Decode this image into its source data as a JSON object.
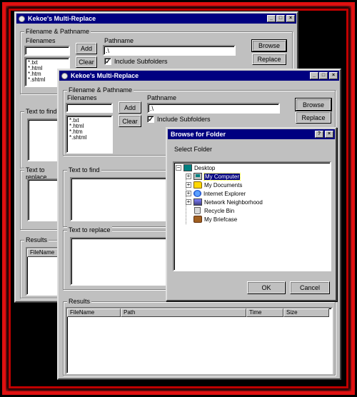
{
  "back_window": {
    "title": "Kekoe's Multi-Replace",
    "group_filename": "Filename & Pathname",
    "filenames_label": "Filenames",
    "filenames_list": [
      "*.txt",
      "*.html",
      "*.htm",
      "*.shtml"
    ],
    "add_label": "Add",
    "clear_label": "Clear",
    "pathname_label": "Pathname",
    "pathname_value": ".\\",
    "include_subfolders": "Include Subfolders",
    "browse_label": "Browse",
    "replace_label": "Replace",
    "text_to_find": "Text to find",
    "text_to_replace": "Text to replace",
    "results_label": "Results",
    "results_columns": [
      "FileName"
    ]
  },
  "front_window": {
    "title": "Kekoe's Multi-Replace",
    "group_filename": "Filename & Pathname",
    "filenames_label": "Filenames",
    "filenames_list": [
      "*.txt",
      "*.html",
      "*.htm",
      "*.shtml"
    ],
    "add_label": "Add",
    "clear_label": "Clear",
    "pathname_label": "Pathname",
    "pathname_value": ".\\",
    "include_subfolders": "Include Subfolders",
    "include_subfolders_checked": true,
    "browse_label": "Browse",
    "replace_label": "Replace",
    "text_to_find": "Text to find",
    "text_to_replace": "Text to replace",
    "results_label": "Results",
    "results_columns": [
      "FileName",
      "Path",
      "Time",
      "Size"
    ]
  },
  "dialog": {
    "title": "Browse for Folder",
    "help_glyph": "?",
    "close_glyph": "×",
    "select_folder": "Select Folder",
    "tree": [
      {
        "label": "Desktop",
        "icon": "desktop-icon",
        "expander": "−"
      },
      {
        "label": "My Computer",
        "icon": "computer-icon",
        "expander": "+",
        "selected": true
      },
      {
        "label": "My Documents",
        "icon": "folder-icon",
        "expander": "+"
      },
      {
        "label": "Internet Explorer",
        "icon": "internet-explorer-icon",
        "expander": "+"
      },
      {
        "label": "Network Neighborhood",
        "icon": "network-icon",
        "expander": "+"
      },
      {
        "label": "Recycle Bin",
        "icon": "recycle-bin-icon",
        "expander": ""
      },
      {
        "label": "My Briefcase",
        "icon": "briefcase-icon",
        "expander": ""
      }
    ],
    "ok_label": "OK",
    "cancel_label": "Cancel"
  },
  "window_controls": {
    "minimize": "_",
    "maximize": "□",
    "close": "×"
  },
  "colors": {
    "border_red": "#e01010",
    "titlebar": "#000080",
    "face": "#c0c0c0"
  }
}
